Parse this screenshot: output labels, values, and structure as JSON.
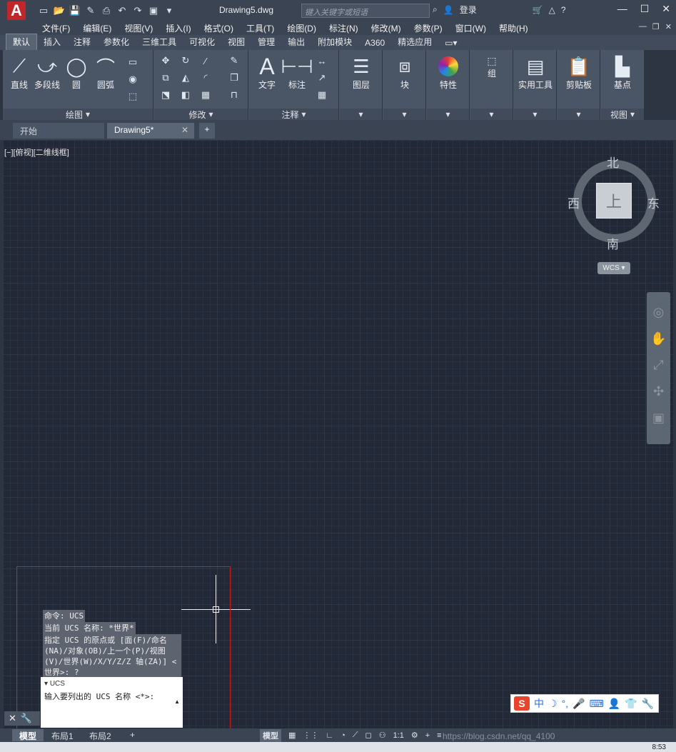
{
  "titlebar": {
    "document": "Drawing5.dwg",
    "search_placeholder": "键入关键字或短语",
    "login": "登录"
  },
  "menubar": {
    "items": [
      "文件(F)",
      "编辑(E)",
      "视图(V)",
      "插入(I)",
      "格式(O)",
      "工具(T)",
      "绘图(D)",
      "标注(N)",
      "修改(M)",
      "参数(P)",
      "窗口(W)",
      "帮助(H)"
    ]
  },
  "ribbon_tabs": [
    "默认",
    "插入",
    "注释",
    "参数化",
    "三维工具",
    "可视化",
    "视图",
    "管理",
    "输出",
    "附加模块",
    "A360",
    "精选应用"
  ],
  "ribbon": {
    "draw": {
      "footer": "绘图",
      "line": "直线",
      "polyline": "多段线",
      "circle": "圆",
      "arc": "圆弧"
    },
    "modify": {
      "footer": "修改"
    },
    "annotation": {
      "footer": "注释",
      "text": "文字",
      "dimension": "标注"
    },
    "layers": "图层",
    "block": "块",
    "properties": "特性",
    "group": "组",
    "utilities": "实用工具",
    "clipboard": "剪贴板",
    "view": {
      "footer": "视图",
      "basepoint": "基点"
    }
  },
  "file_tabs": {
    "start": "开始",
    "doc": "Drawing5*"
  },
  "viewport_label": "[−][俯视][二维线框]",
  "viewcube": {
    "north": "北",
    "south": "南",
    "east": "东",
    "west": "西",
    "top": "上"
  },
  "wcs": "WCS",
  "command": {
    "line1": "命令: UCS",
    "line2": "当前 UCS 名称: *世界*",
    "line3": "指定 UCS 的原点或 [面(F)/命名(NA)/对象(OB)/上一个(P)/视图(V)/世界(W)/X/Y/Z/Z 轴(ZA)] <世界>: ?",
    "input_header": "UCS",
    "input_prompt": "输入要列出的 UCS 名称 <*>:"
  },
  "layout_tabs": {
    "model": "模型",
    "layout1": "布局1",
    "layout2": "布局2"
  },
  "status": {
    "model": "模型",
    "scale": "1:1"
  },
  "ime": {
    "lang": "中"
  },
  "taskbar": {
    "clock": "8:53"
  },
  "watermark": "https://blog.csdn.net/qq_4100"
}
